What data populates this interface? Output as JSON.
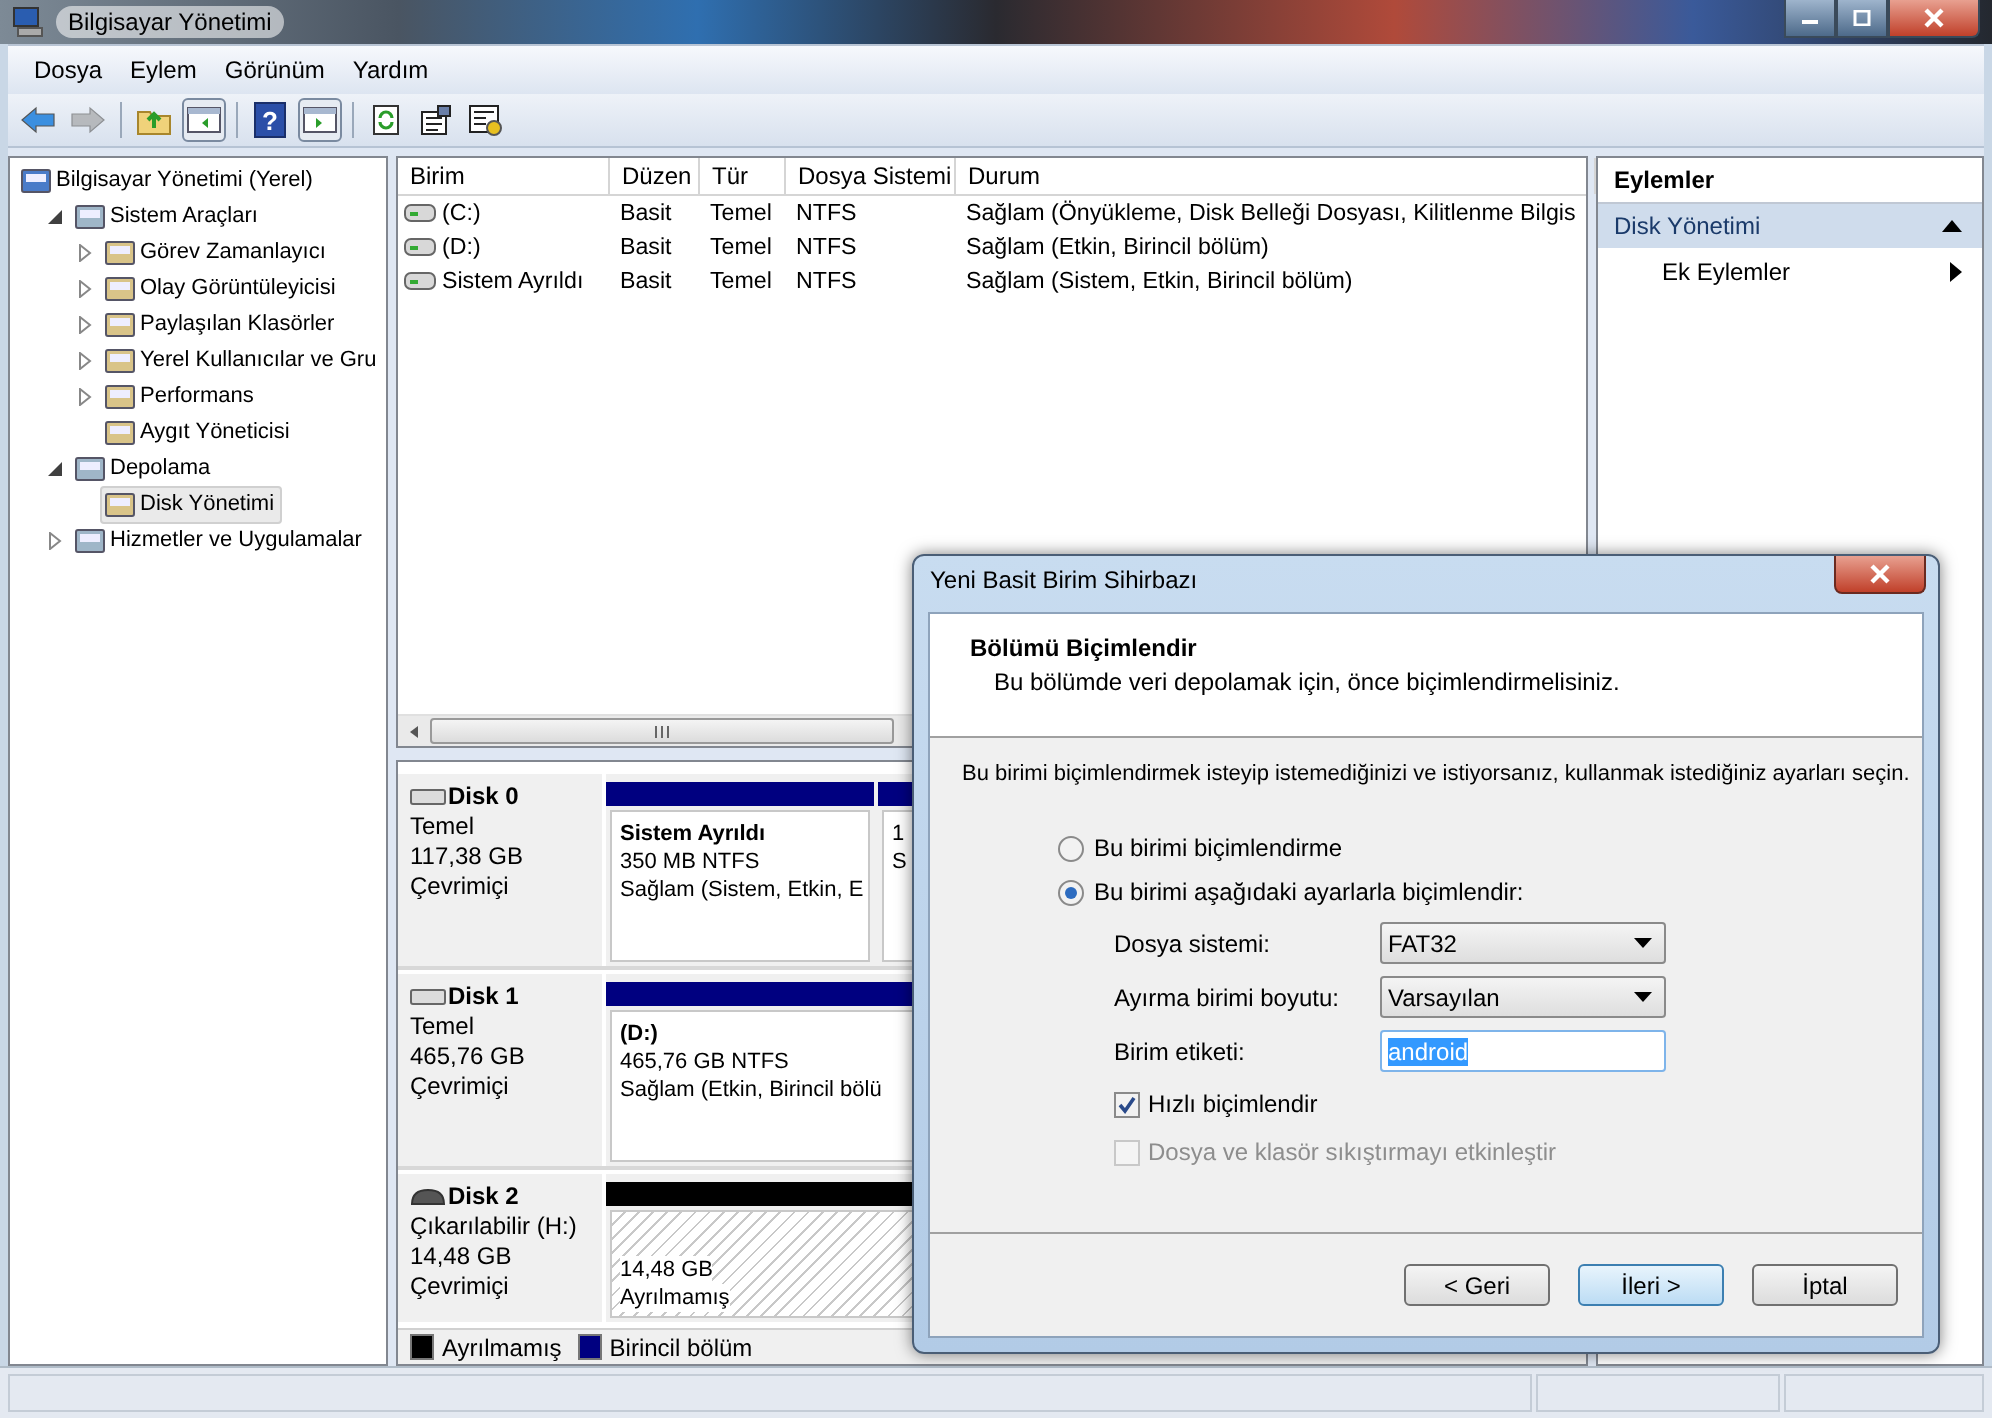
{
  "window": {
    "title": "Bilgisayar Yönetimi"
  },
  "menu": [
    "Dosya",
    "Eylem",
    "Görünüm",
    "Yardım"
  ],
  "toolbar": [
    {
      "kind": "back",
      "disabled": false,
      "pressed": false
    },
    {
      "kind": "forward",
      "disabled": true,
      "pressed": false
    },
    {
      "kind": "separator"
    },
    {
      "kind": "up",
      "disabled": false,
      "pressed": false
    },
    {
      "kind": "tree_pane",
      "disabled": false,
      "pressed": true
    },
    {
      "kind": "separator"
    },
    {
      "kind": "help",
      "glyph": "?",
      "disabled": false,
      "pressed": false
    },
    {
      "kind": "action_pane",
      "disabled": false,
      "pressed": true
    },
    {
      "kind": "separator"
    },
    {
      "kind": "refresh",
      "disabled": false,
      "pressed": false
    },
    {
      "kind": "properties",
      "disabled": false,
      "pressed": false
    },
    {
      "kind": "export",
      "disabled": false,
      "pressed": false
    }
  ],
  "tree": [
    {
      "label": "Bilgisayar Yönetimi (Yerel)",
      "selected": false,
      "children": [
        {
          "label": "Sistem Araçları",
          "expanded": true,
          "selected": false,
          "children": [
            {
              "label": "Görev Zamanlayıcı",
              "expanded": false,
              "selected": false
            },
            {
              "label": "Olay Görüntüleyicisi",
              "expanded": false,
              "selected": false
            },
            {
              "label": "Paylaşılan Klasörler",
              "expanded": false,
              "selected": false
            },
            {
              "label": "Yerel Kullanıcılar ve Gru",
              "expanded": false,
              "selected": false
            },
            {
              "label": "Performans",
              "expanded": false,
              "selected": false
            },
            {
              "label": "Aygıt Yöneticisi",
              "selected": false
            }
          ]
        },
        {
          "label": "Depolama",
          "expanded": true,
          "selected": false,
          "children": [
            {
              "label": "Disk Yönetimi",
              "selected": true
            }
          ]
        },
        {
          "label": "Hizmetler ve Uygulamalar",
          "expanded": false,
          "selected": false
        }
      ]
    }
  ],
  "volumes": {
    "columns": [
      "Birim",
      "Düzen",
      "Tür",
      "Dosya Sistemi",
      "Durum"
    ],
    "rows": [
      {
        "cells": [
          "(C:)",
          "Basit",
          "Temel",
          "NTFS",
          "Sağlam (Önyükleme, Disk Belleği Dosyası, Kilitlenme Bilgis"
        ]
      },
      {
        "cells": [
          "(D:)",
          "Basit",
          "Temel",
          "NTFS",
          "Sağlam (Etkin, Birincil bölüm)"
        ]
      },
      {
        "cells": [
          "Sistem Ayrıldı",
          "Basit",
          "Temel",
          "NTFS",
          "Sağlam (Sistem, Etkin, Birincil bölüm)"
        ]
      }
    ]
  },
  "disks": [
    {
      "name": "Disk 0",
      "kind": "fixed",
      "type": "Temel",
      "size": "117,38 GB",
      "status": "Çevrimiçi",
      "partitions": [
        {
          "kind": "primary",
          "title": "Sistem Ayrıldı",
          "size": "350 MB NTFS",
          "status": "Sağlam (Sistem, Etkin, E"
        },
        {
          "kind": "primary",
          "size": "1",
          "status": "S"
        }
      ]
    },
    {
      "name": "Disk 1",
      "kind": "fixed",
      "type": "Temel",
      "size": "465,76 GB",
      "status": "Çevrimiçi",
      "partitions": [
        {
          "kind": "primary",
          "title": "(D:)",
          "size": "465,76 GB NTFS",
          "status": "Sağlam (Etkin, Birincil bölü"
        }
      ]
    },
    {
      "name": "Disk 2",
      "kind": "removable",
      "type": "Çıkarılabilir (H:)",
      "size": "14,48 GB",
      "status": "Çevrimiçi",
      "partitions": [
        {
          "kind": "unallocated",
          "size": "14,48 GB",
          "status": "Ayrılmamış"
        }
      ]
    }
  ],
  "legend": [
    {
      "label": "Ayrılmamış",
      "color": "#000000"
    },
    {
      "label": "Birincil bölüm",
      "color": "#000080"
    }
  ],
  "actions": {
    "title": "Eylemler",
    "items": [
      {
        "kind": "header",
        "label": "Disk Yönetimi",
        "expanded": true
      },
      {
        "kind": "item",
        "label": "Ek Eylemler"
      }
    ]
  },
  "dialog": {
    "title": "Yeni Basit Birim Sihirbazı",
    "heading": "Bölümü Biçimlendir",
    "subheading": "Bu bölümde veri depolamak için, önce biçimlendirmelisiniz.",
    "intro": "Bu birimi biçimlendirmek isteyip istemediğinizi ve istiyorsanız, kullanmak istediğiniz ayarları seçin.",
    "radios": [
      {
        "label": "Bu birimi biçimlendirme",
        "selected": false
      },
      {
        "label": "Bu birimi aşağıdaki ayarlarla biçimlendir:",
        "selected": true
      }
    ],
    "fields": [
      {
        "kind": "dropdown",
        "label": "Dosya sistemi:",
        "value": "FAT32"
      },
      {
        "kind": "dropdown",
        "label": "Ayırma birimi boyutu:",
        "value": "Varsayılan"
      },
      {
        "kind": "text",
        "label": "Birim etiketi:",
        "value": "android",
        "text_selected": true
      }
    ],
    "checkboxes": [
      {
        "label": "Hızlı biçimlendir",
        "checked": true,
        "disabled": false
      },
      {
        "label": "Dosya ve klasör sıkıştırmayı etkinleştir",
        "checked": false,
        "disabled": true
      }
    ],
    "buttons": [
      {
        "label": "< Geri",
        "default": false
      },
      {
        "label": "İleri >",
        "default": true
      },
      {
        "label": "İptal",
        "default": false
      }
    ]
  }
}
